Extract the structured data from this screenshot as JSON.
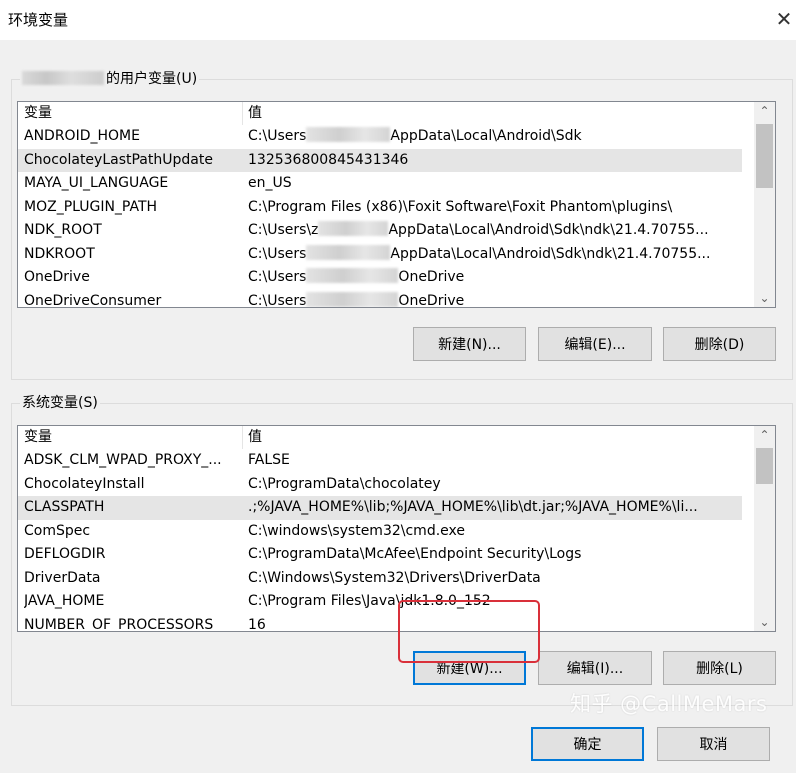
{
  "window": {
    "title": "环境变量"
  },
  "user_vars": {
    "label": "的用户变量(U)",
    "columns": {
      "name": "变量",
      "value": "值"
    },
    "rows": [
      {
        "name": "ANDROID_HOME",
        "pre": "C:\\Users",
        "post": "AppData\\Local\\Android\\Sdk"
      },
      {
        "name": "ChocolateyLastPathUpdate",
        "pre": "132536800845431346",
        "post": ""
      },
      {
        "name": "MAYA_UI_LANGUAGE",
        "pre": "en_US",
        "post": ""
      },
      {
        "name": "MOZ_PLUGIN_PATH",
        "pre": "C:\\Program Files (x86)\\Foxit Software\\Foxit Phantom\\plugins\\",
        "post": ""
      },
      {
        "name": "NDK_ROOT",
        "pre": "C:\\Users\\z",
        "post": "AppData\\Local\\Android\\Sdk\\ndk\\21.4.70755..."
      },
      {
        "name": "NDKROOT",
        "pre": "C:\\Users",
        "post": "AppData\\Local\\Android\\Sdk\\ndk\\21.4.70755..."
      },
      {
        "name": "OneDrive",
        "pre": "C:\\Users",
        "post": "OneDrive"
      },
      {
        "name": "OneDriveConsumer",
        "pre": "C:\\Users",
        "post": "OneDrive"
      }
    ],
    "buttons": {
      "new": "新建(N)...",
      "edit": "编辑(E)...",
      "delete": "删除(D)"
    }
  },
  "sys_vars": {
    "label": "系统变量(S)",
    "columns": {
      "name": "变量",
      "value": "值"
    },
    "rows": [
      {
        "name": "ADSK_CLM_WPAD_PROXY_...",
        "value": "FALSE"
      },
      {
        "name": "ChocolateyInstall",
        "value": "C:\\ProgramData\\chocolatey"
      },
      {
        "name": "CLASSPATH",
        "value": ".;%JAVA_HOME%\\lib;%JAVA_HOME%\\lib\\dt.jar;%JAVA_HOME%\\li..."
      },
      {
        "name": "ComSpec",
        "value": "C:\\windows\\system32\\cmd.exe"
      },
      {
        "name": "DEFLOGDIR",
        "value": "C:\\ProgramData\\McAfee\\Endpoint Security\\Logs"
      },
      {
        "name": "DriverData",
        "value": "C:\\Windows\\System32\\Drivers\\DriverData"
      },
      {
        "name": "JAVA_HOME",
        "value": "C:\\Program Files\\Java\\jdk1.8.0_152"
      },
      {
        "name": "NUMBER_OF_PROCESSORS",
        "value": "16"
      }
    ],
    "buttons": {
      "new": "新建(W)...",
      "edit": "编辑(I)...",
      "delete": "删除(L)"
    }
  },
  "footer": {
    "ok": "确定",
    "cancel": "取消"
  },
  "watermark": "知乎 @CallMeMars",
  "colors": {
    "highlight": "#d9303a",
    "focus": "#0078d7"
  }
}
